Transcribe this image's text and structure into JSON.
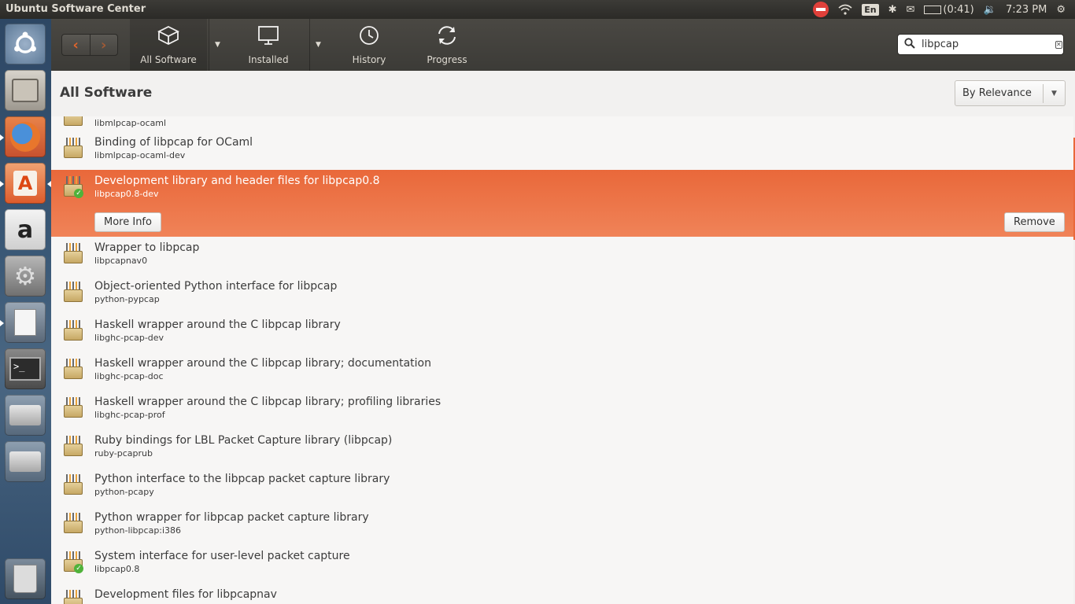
{
  "panel": {
    "app_title": "Ubuntu Software Center",
    "lang": "En",
    "battery": "(0:41)",
    "time": "7:23 PM"
  },
  "launcher": {
    "items": [
      "ubuntu-logo-icon",
      "files-icon",
      "firefox-icon",
      "software-center-icon",
      "amazon-icon",
      "system-settings-icon",
      "text-editor-icon",
      "terminal-icon",
      "drive-icon",
      "drive-icon",
      "trash-icon"
    ]
  },
  "toolbar": {
    "back": "‹",
    "forward": "›",
    "all_software": "All Software",
    "installed": "Installed",
    "history": "History",
    "progress": "Progress"
  },
  "search": {
    "value": "libpcap"
  },
  "header": {
    "title": "All Software",
    "sort": "By Relevance"
  },
  "list": {
    "partial_top": {
      "title": "",
      "pkg": "libmlpcap-ocaml"
    },
    "rows": [
      {
        "title": "Binding of libpcap for OCaml",
        "pkg": "libmlpcap-ocaml-dev",
        "installed": false
      },
      {
        "title": "Development library and header files for libpcap0.8",
        "pkg": "libpcap0.8-dev",
        "installed": true
      },
      {
        "title": "Wrapper to libpcap",
        "pkg": "libpcapnav0",
        "installed": false
      },
      {
        "title": "Object-oriented Python interface for libpcap",
        "pkg": "python-pypcap",
        "installed": false
      },
      {
        "title": "Haskell wrapper around the C libpcap library",
        "pkg": "libghc-pcap-dev",
        "installed": false
      },
      {
        "title": "Haskell wrapper around the C libpcap library; documentation",
        "pkg": "libghc-pcap-doc",
        "installed": false
      },
      {
        "title": "Haskell wrapper around the C libpcap library; profiling libraries",
        "pkg": "libghc-pcap-prof",
        "installed": false
      },
      {
        "title": "Ruby bindings for LBL Packet Capture library (libpcap)",
        "pkg": "ruby-pcaprub",
        "installed": false
      },
      {
        "title": "Python interface to the libpcap packet capture library",
        "pkg": "python-pcapy",
        "installed": false
      },
      {
        "title": "Python wrapper for libpcap packet capture library",
        "pkg": "python-libpcap:i386",
        "installed": false
      },
      {
        "title": "System interface for user-level packet capture",
        "pkg": "libpcap0.8",
        "installed": true
      },
      {
        "title": "Development files for libpcapnav",
        "pkg": "",
        "installed": false
      }
    ],
    "more_info": "More Info",
    "remove": "Remove"
  }
}
